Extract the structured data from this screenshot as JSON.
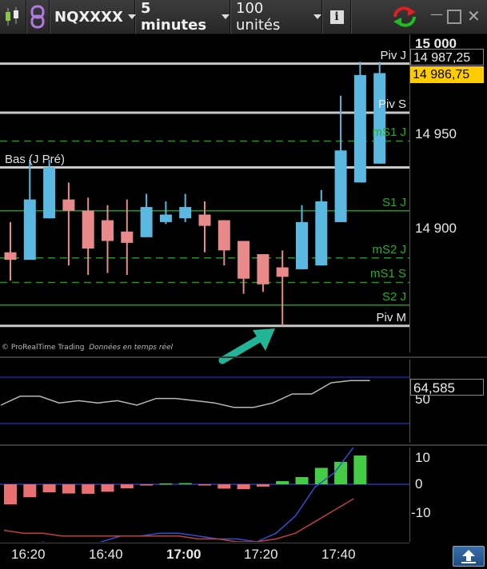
{
  "toolbar": {
    "symbol": "NQXXXX",
    "interval": "5 minutes",
    "units": "100 unités",
    "info_icon": "info-icon",
    "refresh_icon": "refresh-arrows-icon"
  },
  "price_panel": {
    "top_tick": "15 000",
    "ticks": [
      "14 950",
      "14 900"
    ],
    "last_price": "14 987,25",
    "current_price": "14 986,75",
    "credit": "© ProRealTime Trading",
    "credit_italic": "Données en temps réel",
    "levels": [
      {
        "label": "Piv J",
        "price": 14987,
        "color": "#c8c8c8",
        "style": "solid"
      },
      {
        "label": "Piv S",
        "price": 14961,
        "color": "#c8c8c8",
        "style": "solid"
      },
      {
        "label": "mS1 J",
        "price": 14946,
        "color": "#1a9a1a",
        "style": "dashed"
      },
      {
        "label": "",
        "price": 14932,
        "color": "#c8c8c8",
        "style": "solid"
      },
      {
        "label": "S1 J",
        "price": 14909,
        "color": "#1a9a1a",
        "style": "solid"
      },
      {
        "label": "mS2 J",
        "price": 14884,
        "color": "#1a9a1a",
        "style": "dashed"
      },
      {
        "label": "mS1 S",
        "price": 14871,
        "color": "#1a9a1a",
        "style": "dashed"
      },
      {
        "label": "S2 J",
        "price": 14859,
        "color": "#1a9a1a",
        "style": "solid"
      },
      {
        "label": "Piv M",
        "price": 14848,
        "color": "#c8c8c8",
        "style": "solid"
      }
    ],
    "prev_low_label": "Bas (J Pré)"
  },
  "oscillator_panel": {
    "tick": "50",
    "value": "64,585"
  },
  "histogram_panel": {
    "ticks": [
      "10",
      "0",
      "-10"
    ]
  },
  "x_axis": {
    "labels": [
      "16:20",
      "16:40",
      "17:00",
      "17:20",
      "17:40"
    ]
  },
  "colors": {
    "up": "#5bb8e0",
    "down": "#e88a8a",
    "hist_up": "#44cc44",
    "hist_down": "#e87070",
    "highlight": "#ffcc00"
  },
  "chart_data": {
    "type": "candlestick",
    "candles": [
      {
        "o": 14887,
        "h": 14903,
        "l": 14872,
        "c": 14883
      },
      {
        "o": 14883,
        "h": 14936,
        "l": 14883,
        "c": 14915
      },
      {
        "o": 14905,
        "h": 14936,
        "l": 14905,
        "c": 14932
      },
      {
        "o": 14915,
        "h": 14924,
        "l": 14880,
        "c": 14909
      },
      {
        "o": 14909,
        "h": 14916,
        "l": 14875,
        "c": 14889
      },
      {
        "o": 14904,
        "h": 14912,
        "l": 14876,
        "c": 14893
      },
      {
        "o": 14898,
        "h": 14915,
        "l": 14875,
        "c": 14892
      },
      {
        "o": 14895,
        "h": 14918,
        "l": 14895,
        "c": 14911
      },
      {
        "o": 14903,
        "h": 14914,
        "l": 14902,
        "c": 14907
      },
      {
        "o": 14905,
        "h": 14918,
        "l": 14903,
        "c": 14911
      },
      {
        "o": 14907,
        "h": 14914,
        "l": 14887,
        "c": 14901
      },
      {
        "o": 14904,
        "h": 14904,
        "l": 14880,
        "c": 14888
      },
      {
        "o": 14893,
        "h": 14893,
        "l": 14865,
        "c": 14873
      },
      {
        "o": 14886,
        "h": 14886,
        "l": 14866,
        "c": 14870
      },
      {
        "o": 14879,
        "h": 14888,
        "l": 14848,
        "c": 14874
      },
      {
        "o": 14878,
        "h": 14912,
        "l": 14878,
        "c": 14903
      },
      {
        "o": 14880,
        "h": 14920,
        "l": 14880,
        "c": 14914
      },
      {
        "o": 14903,
        "h": 14970,
        "l": 14903,
        "c": 14941
      },
      {
        "o": 14924,
        "h": 14988,
        "l": 14924,
        "c": 14981
      },
      {
        "o": 14934,
        "h": 14988,
        "l": 14934,
        "c": 14982
      }
    ],
    "oscillator": [
      55,
      59,
      59,
      56,
      57,
      56,
      57,
      55,
      58,
      58,
      57,
      56,
      54,
      54,
      56,
      60,
      60,
      65,
      66,
      66
    ],
    "histogram": [
      -7,
      -4.5,
      -2.8,
      -3.2,
      -3.3,
      -2.6,
      -1.4,
      -0.4,
      0.3,
      0.4,
      -0.2,
      -1.5,
      -1.7,
      -0.8,
      1.1,
      2.5,
      5.7,
      7.8,
      10
    ],
    "hist_line_blue": [
      -23,
      -23,
      -20,
      -22,
      -23,
      -20,
      -18,
      -18,
      -17,
      -17,
      -18,
      -19,
      -19,
      -20,
      -17,
      -11,
      -1,
      4,
      13
    ],
    "hist_line_red": [
      -16,
      -17,
      -17,
      -18,
      -18,
      -18,
      -18,
      -18,
      -18,
      -18,
      -19,
      -19,
      -20,
      -20,
      -19,
      -17,
      -13,
      -9,
      -5
    ]
  }
}
